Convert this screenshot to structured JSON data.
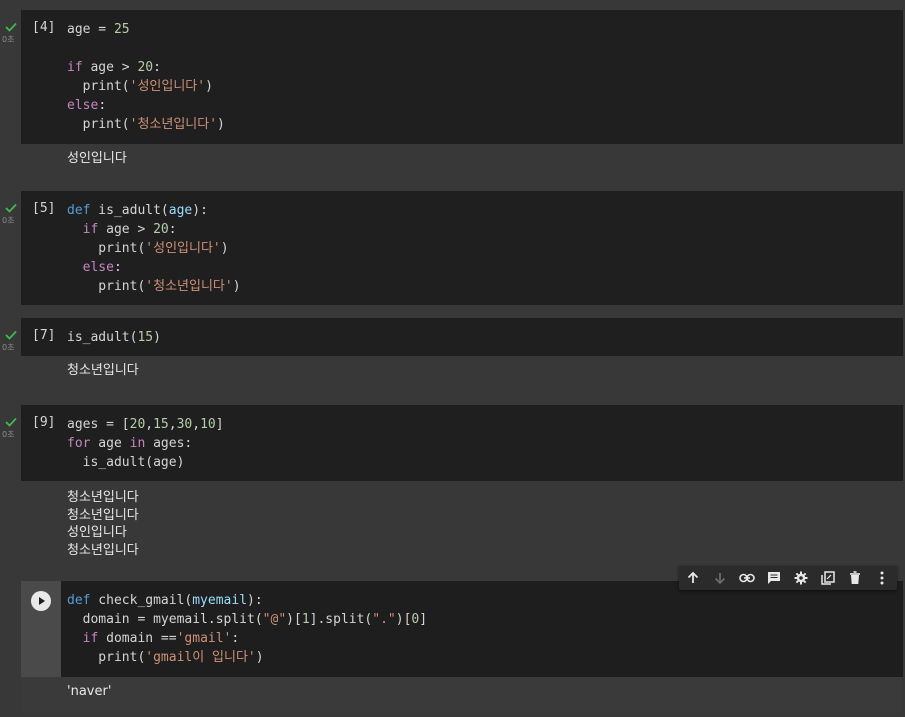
{
  "cells": [
    {
      "count": "[4]",
      "time": "0초",
      "code_lines": [
        [
          [
            "age = ",
            ""
          ],
          [
            "25",
            "num"
          ]
        ],
        [],
        [
          [
            "if",
            "kw"
          ],
          [
            " age > ",
            ""
          ],
          [
            "20",
            "num"
          ],
          [
            ":",
            ""
          ]
        ],
        [
          [
            "  print(",
            ""
          ],
          [
            "'성인입니다'",
            "str"
          ],
          [
            ")",
            ""
          ]
        ],
        [
          [
            "else",
            "kw"
          ],
          [
            ":",
            ""
          ]
        ],
        [
          [
            "  print(",
            ""
          ],
          [
            "'청소년입니다'",
            "str"
          ],
          [
            ")",
            ""
          ]
        ]
      ],
      "output": [
        "성인입니다"
      ]
    },
    {
      "count": "[5]",
      "time": "0초",
      "code_lines": [
        [
          [
            "def",
            "kw2"
          ],
          [
            " is_adult(",
            ""
          ],
          [
            "age",
            "param"
          ],
          [
            "):",
            ""
          ]
        ],
        [
          [
            "  ",
            ""
          ],
          [
            "if",
            "kw"
          ],
          [
            " age > ",
            ""
          ],
          [
            "20",
            "num"
          ],
          [
            ":",
            ""
          ]
        ],
        [
          [
            "    print(",
            ""
          ],
          [
            "'성인입니다'",
            "str"
          ],
          [
            ")",
            ""
          ]
        ],
        [
          [
            "  ",
            ""
          ],
          [
            "else",
            "kw"
          ],
          [
            ":",
            ""
          ]
        ],
        [
          [
            "    print(",
            ""
          ],
          [
            "'청소년입니다'",
            "str"
          ],
          [
            ")",
            ""
          ]
        ]
      ],
      "output": []
    },
    {
      "count": "[7]",
      "time": "0초",
      "code_lines": [
        [
          [
            "is_adult(",
            ""
          ],
          [
            "15",
            "num"
          ],
          [
            ")",
            ""
          ]
        ]
      ],
      "output": [
        "청소년입니다"
      ]
    },
    {
      "count": "[9]",
      "time": "0초",
      "code_lines": [
        [
          [
            "ages = [",
            ""
          ],
          [
            "20",
            "num"
          ],
          [
            ",",
            ""
          ],
          [
            "15",
            "num"
          ],
          [
            ",",
            ""
          ],
          [
            "30",
            "num"
          ],
          [
            ",",
            ""
          ],
          [
            "10",
            "num"
          ],
          [
            "]",
            ""
          ]
        ],
        [
          [
            "for",
            "kw"
          ],
          [
            " age ",
            ""
          ],
          [
            "in",
            "kw"
          ],
          [
            " ages:",
            ""
          ]
        ],
        [
          [
            "  is_adult(age)",
            ""
          ]
        ]
      ],
      "output": [
        "청소년입니다",
        "청소년입니다",
        "성인입니다",
        "청소년입니다"
      ]
    },
    {
      "count": "",
      "time": "",
      "code_lines": [
        [
          [
            "def",
            "kw2"
          ],
          [
            " check_gmail(",
            ""
          ],
          [
            "myemail",
            "param"
          ],
          [
            "):",
            ""
          ]
        ],
        [
          [
            "  domain = myemail.split(",
            ""
          ],
          [
            "\"@\"",
            "str"
          ],
          [
            ")[",
            ""
          ],
          [
            "1",
            "num"
          ],
          [
            "].split(",
            ""
          ],
          [
            "\".\"",
            "str"
          ],
          [
            ")[",
            ""
          ],
          [
            "0",
            "num"
          ],
          [
            "]",
            ""
          ]
        ],
        [
          [
            "  ",
            ""
          ],
          [
            "if",
            "kw"
          ],
          [
            " domain ==",
            ""
          ],
          [
            "'gmail'",
            "str"
          ],
          [
            ":",
            ""
          ]
        ],
        [
          [
            "    print(",
            ""
          ],
          [
            "'gmail이 입니다'",
            "str"
          ],
          [
            ")",
            ""
          ]
        ]
      ],
      "output": [
        "'naver'"
      ]
    }
  ],
  "toolbar": [
    "arrow-up-icon",
    "arrow-down-icon",
    "link-icon",
    "comment-icon",
    "gear-icon",
    "mirror-cell-icon",
    "trash-icon",
    "more-vert-icon"
  ],
  "colors": {
    "background": "#383838",
    "code_bg": "#1f1f1f",
    "check": "#3fb950",
    "keyword": "#c586c0",
    "def_keyword": "#569cd6",
    "number": "#b5cea8",
    "string": "#ce9178"
  }
}
